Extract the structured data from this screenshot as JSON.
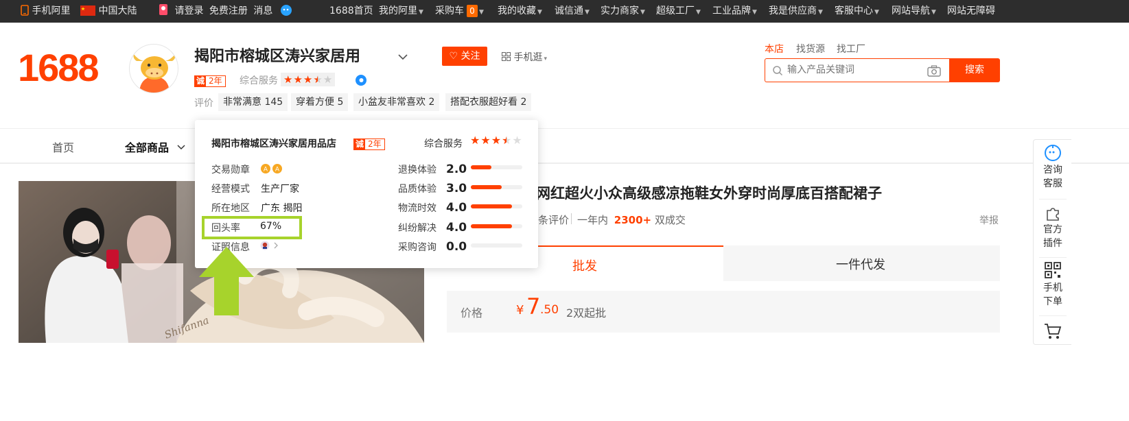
{
  "topbar": {
    "mobile_ali": "手机阿里",
    "region": "中国大陆",
    "login": "请登录",
    "register": "免费注册",
    "messages": "消息",
    "home_1688": "1688首页",
    "my_ali": "我的阿里",
    "cart": "采购车",
    "cart_count": "0",
    "favorites": "我的收藏",
    "chengxintong": "诚信通",
    "strength_merchant": "实力商家",
    "super_factory": "超级工厂",
    "industrial_brand": "工业品牌",
    "supplier": "我是供应商",
    "service_center": "客服中心",
    "site_nav": "网站导航",
    "accessibility": "网站无障碍"
  },
  "header": {
    "logo": "1688",
    "shop_name": "揭阳市榕城区涛兴家居用",
    "cheng_badge": "诚",
    "years": "2年",
    "service_label": "综合服务",
    "follow_label": "关注",
    "mobile_browse": "手机逛",
    "review_label": "评价",
    "tags": [
      "非常满意 145",
      "穿着方便 5",
      "小盆友非常喜欢 2",
      "搭配衣服超好看 2"
    ]
  },
  "search": {
    "tabs": [
      "本店",
      "找货源",
      "找工厂"
    ],
    "placeholder": "输入产品关键词",
    "button": "搜索"
  },
  "nav": {
    "home": "首页",
    "all_products": "全部商品"
  },
  "popup": {
    "shop_full_name": "揭阳市榕城区涛兴家居用品店",
    "cheng_badge": "诚",
    "years": "2年",
    "service_label": "综合服务",
    "left_rows": [
      {
        "label": "交易勋章",
        "value": ""
      },
      {
        "label": "经营模式",
        "value": "生产厂家"
      },
      {
        "label": "所在地区",
        "value": "广东 揭阳"
      },
      {
        "label": "回头率",
        "value": "67%"
      },
      {
        "label": "证照信息",
        "value": ""
      }
    ],
    "metrics": [
      {
        "label": "退换体验",
        "score": "2.0",
        "level": 0.4
      },
      {
        "label": "品质体验",
        "score": "3.0",
        "level": 0.6
      },
      {
        "label": "物流时效",
        "score": "4.0",
        "level": 0.8
      },
      {
        "label": "纠纷解决",
        "score": "4.0",
        "level": 0.8
      },
      {
        "label": "采购咨询",
        "score": "0.0",
        "level": 0.0
      }
    ]
  },
  "product": {
    "title": "季网红超火小众高级感凉拖鞋女外穿时尚厚底百搭配裙子",
    "reviews_suffix": "条评价",
    "year_label": "一年内",
    "sold_count": "2300+",
    "sold_suffix": "双成交",
    "report": "举报",
    "tab_wholesale": "批发",
    "tab_dropship": "一件代发",
    "price_label": "价格",
    "currency": "¥",
    "price_int": "7",
    "price_dec": ".50",
    "moq": "2双起批",
    "image_text": "Shifanna"
  },
  "toolbar": {
    "consult": [
      "咨询",
      "客服"
    ],
    "plugin": [
      "官方",
      "插件"
    ],
    "mobile_order": [
      "手机",
      "下单"
    ]
  },
  "colors": {
    "brand": "#ff4000",
    "highlight": "#a7d32c",
    "topbar": "#2d2d2d"
  }
}
